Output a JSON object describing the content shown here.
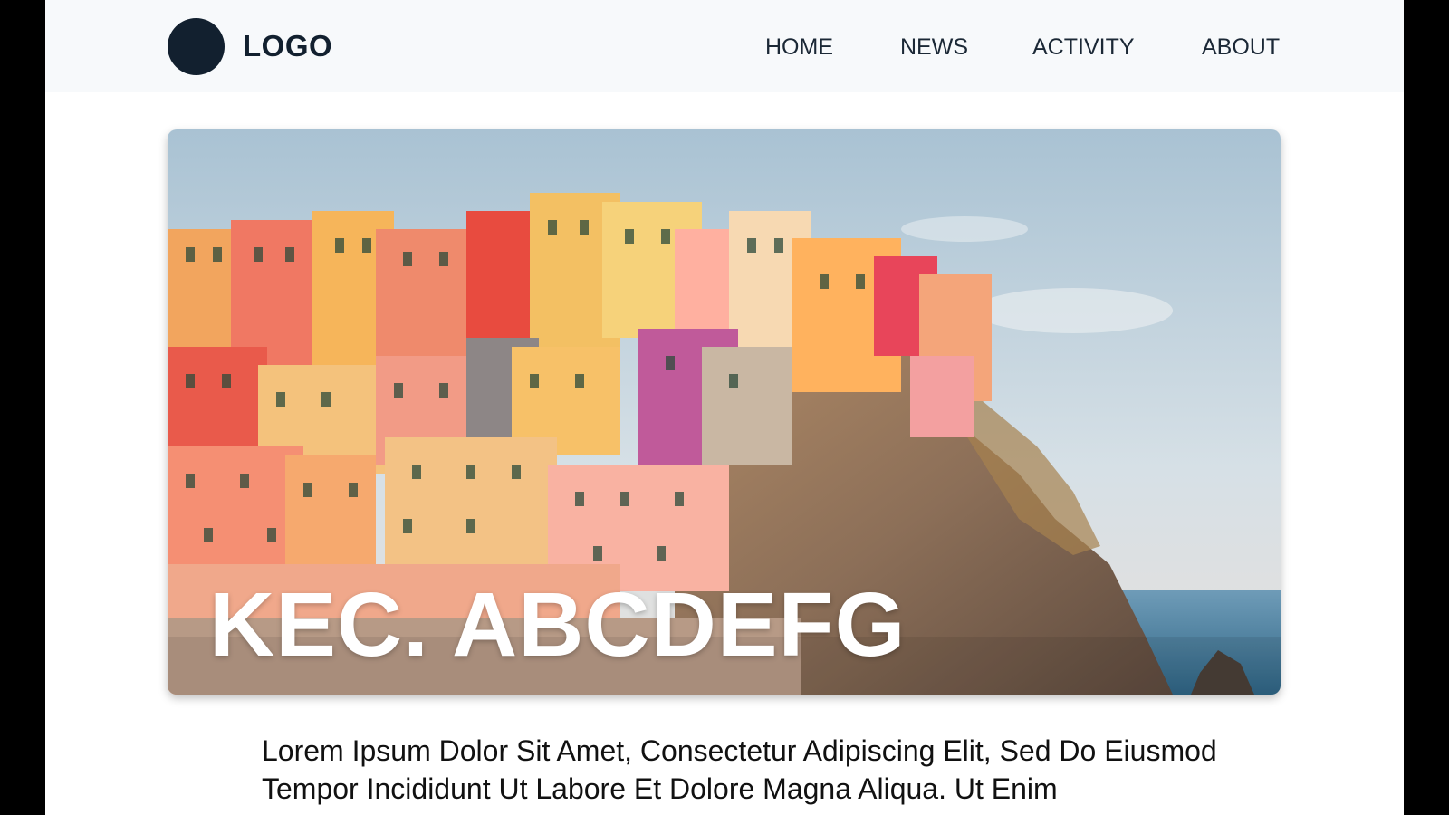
{
  "header": {
    "logo_text": "LOGO",
    "nav": [
      {
        "label": "HOME"
      },
      {
        "label": "NEWS"
      },
      {
        "label": "ACTIVITY"
      },
      {
        "label": "ABOUT"
      }
    ]
  },
  "hero": {
    "title": "KEC. ABCDEFG"
  },
  "content": {
    "paragraph": "Lorem Ipsum Dolor Sit Amet, Consectetur Adipiscing Elit, Sed Do Eiusmod Tempor Incididunt Ut Labore Et Dolore Magna Aliqua. Ut Enim"
  },
  "colors": {
    "logo": "#12202f",
    "header_bg": "#f7f9fb",
    "frame": "#000000"
  }
}
